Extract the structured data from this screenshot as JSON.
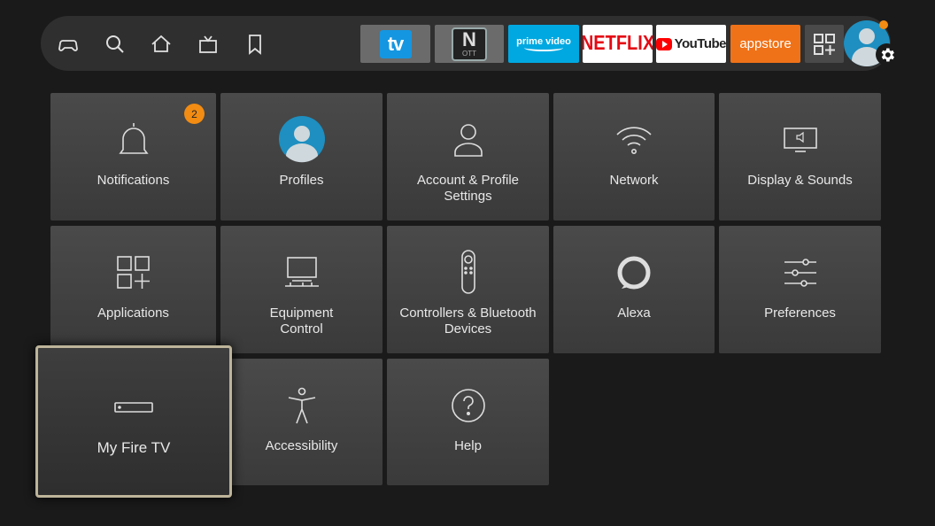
{
  "nav": {
    "icons": [
      "game-controller-icon",
      "search-icon",
      "home-icon",
      "live-tv-icon",
      "bookmark-icon"
    ]
  },
  "apps": {
    "tv_label": "tv",
    "ott_label": "N",
    "ott_sub": "OTT",
    "prime_label": "prime video",
    "netflix_label": "NETFLIX",
    "youtube_label": "YouTube",
    "appstore_label": "appstore"
  },
  "notifications_count": "2",
  "tiles": [
    {
      "label": "Notifications",
      "icon": "bell-icon"
    },
    {
      "label": "Profiles",
      "icon": "profile-avatar-icon"
    },
    {
      "label": "Account & Profile Settings",
      "icon": "person-icon"
    },
    {
      "label": "Network",
      "icon": "wifi-icon"
    },
    {
      "label": "Display & Sounds",
      "icon": "monitor-speaker-icon"
    },
    {
      "label": "Applications",
      "icon": "apps-grid-icon"
    },
    {
      "label": "Equipment Control",
      "icon": "tv-equipment-icon"
    },
    {
      "label": "Controllers & Bluetooth Devices",
      "icon": "remote-icon"
    },
    {
      "label": "Alexa",
      "icon": "alexa-ring-icon"
    },
    {
      "label": "Preferences",
      "icon": "sliders-icon"
    },
    {
      "label": "My Fire TV",
      "icon": "fire-tv-device-icon"
    },
    {
      "label": "Accessibility",
      "icon": "accessibility-icon"
    },
    {
      "label": "Help",
      "icon": "help-icon"
    }
  ],
  "colors": {
    "background": "#1a1a1a",
    "navbar": "#2f2f2f",
    "tile": "#424242",
    "focus_border": "#bdb49a",
    "badge": "#f28c12",
    "accent_blue": "#1e8fc0"
  }
}
